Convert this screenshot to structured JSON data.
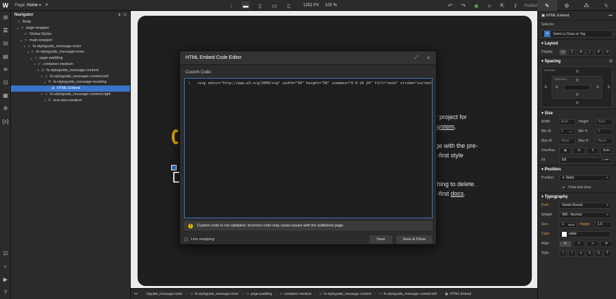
{
  "topbar": {
    "logo": "W",
    "page_label": "Page:",
    "page_name": "Home",
    "width": "1252 PX",
    "zoom": "100 %",
    "publish": "Publish",
    "icons_center": [
      "desktop-icon",
      "tablet-icon",
      "landscape-icon",
      "mobile-icon"
    ],
    "right_tabs": [
      "brush-icon",
      "gear-icon",
      "interactions-icon",
      "lightning-icon"
    ]
  },
  "navigator": {
    "title": "Navigator",
    "items": [
      {
        "label": "Body",
        "indent": 0,
        "icon": "□",
        "tri": ""
      },
      {
        "label": "page-wrapper",
        "indent": 1,
        "icon": "□",
        "tri": "▾"
      },
      {
        "label": "Global Styles",
        "indent": 2,
        "icon": "⟐",
        "tri": ""
      },
      {
        "label": "main-wrapper",
        "indent": 2,
        "icon": "□",
        "tri": "▾"
      },
      {
        "label": "fs-styleguide_message-outer",
        "indent": 3,
        "icon": "□",
        "tri": "▾"
      },
      {
        "label": "fs-styleguide_message-inner",
        "indent": 4,
        "icon": "□",
        "tri": "▾"
      },
      {
        "label": "page-padding",
        "indent": 5,
        "icon": "□",
        "tri": "▾"
      },
      {
        "label": "container-medium",
        "indent": 6,
        "icon": "□",
        "tri": "▾"
      },
      {
        "label": "fs-styleguide_message-content",
        "indent": 7,
        "icon": "☷",
        "tri": "▾"
      },
      {
        "label": "fs-styleguide_message-content-left",
        "indent": 8,
        "icon": "□",
        "tri": "▾"
      },
      {
        "label": "fs-styleguide_message-heading",
        "indent": 9,
        "icon": "H",
        "tri": "▸"
      },
      {
        "label": "HTML Embed",
        "indent": 10,
        "icon": "▣",
        "tri": "",
        "selected": true
      },
      {
        "label": "fs-styleguide_message-content-right",
        "indent": 8,
        "icon": "□",
        "tri": "▾"
      },
      {
        "label": "text-size-medium",
        "indent": 9,
        "icon": "☶",
        "tri": "▸"
      }
    ]
  },
  "canvas": {
    "lines": [
      {
        "text": "rter project for",
        "underline": ""
      },
      {
        "text": "",
        "underline": "le system",
        "after": "."
      },
      {
        "text": "page with the pre-",
        "underline": ""
      },
      {
        "text": "ent-first style",
        "underline": ""
      },
      {
        "text": "nothing to delete.",
        "underline": ""
      },
      {
        "text": "ent-first ",
        "underline": "docs",
        "after": "."
      }
    ]
  },
  "modal": {
    "title": "HTML Embed Code Editor",
    "custom_code_label": "Custom Code:",
    "line_number": "1",
    "code": "<svg xmlns=\"http://www.w3.org/2000/svg\" width=\"50\" height=\"50\" viewbox=\"0 0 24 24\" fill=\"none\" stroke=\"currentColor",
    "warning": "Custom code is not validated. Incorrect code may cause issues with the published page.",
    "line_wrapping": "Line wrapping",
    "save": "Save",
    "save_close": "Save & Close"
  },
  "breadcrumbs": [
    "leguide_message-outer",
    "fs-styleguide_message-inner",
    "page-padding",
    "container-medium",
    "fs-styleguide_message-content",
    "fs-styleguide_message-content-left",
    "HTML Embed"
  ],
  "right_panel": {
    "element": "HTML Embed",
    "selector_label": "Selector",
    "select_class": "Select a Class or Tag",
    "layout": "Layout",
    "display_label": "Display",
    "spacing": "Spacing",
    "margin_label": "MARGIN",
    "padding_label": "PADDING",
    "spacing_values": {
      "mt": "0",
      "mr": "0",
      "mb": "0",
      "ml": "0",
      "pt": "0",
      "pr": "0",
      "pb": "0",
      "pl": "0"
    },
    "size": "Size",
    "width_label": "Width",
    "width_val": "Auto",
    "height_label": "Height",
    "height_val": "Auto",
    "minw_label": "Min W",
    "minw_val": "0",
    "minw_unit": "PX",
    "minh_label": "Min H",
    "minh_val": "0",
    "maxw_label": "Max W",
    "maxw_val": "None",
    "maxh_label": "Max H",
    "maxh_val": "None",
    "overflow_label": "Overflow",
    "overflow_auto": "Auto",
    "fit_label": "Fit",
    "fit_val": "Fill",
    "position": "Position",
    "position_label": "Position",
    "position_val": "Static",
    "float_clear": "Float and clear",
    "typography": "Typography",
    "font_label": "Font",
    "font_val": "Varela Round",
    "weight_label": "Weight",
    "weight_val": "400 - Normal",
    "size_label": "Size",
    "size_val": "1",
    "size_unit": "REM",
    "lineh_label": "Height",
    "lineh_val": "1.5",
    "color_label": "Color",
    "color_val": "white",
    "align_label": "Align",
    "style_label": "Style"
  },
  "colors": {
    "accent": "#3a74c9",
    "warning": "#e6b000",
    "label_orange": "#e69b3a"
  }
}
